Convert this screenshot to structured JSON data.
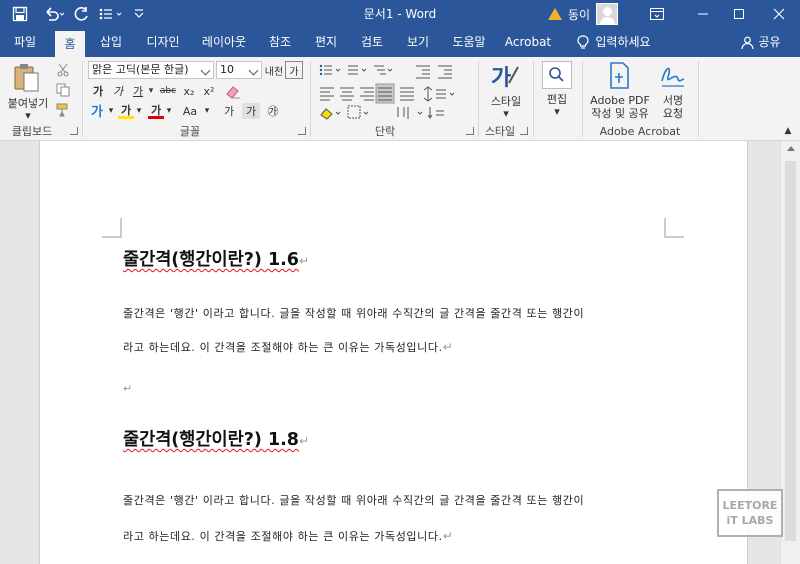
{
  "window": {
    "title": "문서1 - Word",
    "user_label": "동이"
  },
  "tabs": [
    "파일",
    "홈",
    "삽입",
    "디자인",
    "레이아웃",
    "참조",
    "편지",
    "검토",
    "보기",
    "도움말",
    "Acrobat",
    "입력하세요"
  ],
  "share_label": "공유",
  "ribbon": {
    "clipboard": {
      "paste_label": "붙여넣기",
      "group_label": "클립보드"
    },
    "font": {
      "font_name": "맑은 고딕(본문 한글)",
      "font_size": "10",
      "group_label": "글꼴",
      "buttons": [
        "가",
        "가",
        "가",
        "abc",
        "x₂",
        "x²",
        "가",
        "가",
        "Aa",
        "가",
        "가",
        "㉮",
        "내천",
        "가"
      ]
    },
    "paragraph": {
      "group_label": "단락"
    },
    "styles": {
      "button_label": "스타일",
      "group_label": "스타일"
    },
    "editing": {
      "button_label": "편집"
    },
    "acrobat": {
      "pdf_label_1": "Adobe PDF",
      "pdf_label_2": "작성 및 공유",
      "sign_label_1": "서명",
      "sign_label_2": "요청",
      "group_label": "Adobe Acrobat"
    }
  },
  "document": {
    "sections": [
      {
        "heading": "줄간격(행간이란?) 1.6",
        "line1": "줄간격은 '행간' 이라고 합니다. 글을 작성할 때 위아래 수직간의 글 간격을 줄간격 또는 행간이",
        "line2": "라고 하는데요. 이 간격을 조절해야 하는 큰 이유는 가독성입니다."
      },
      {
        "heading": "줄간격(행간이란?) 1.8",
        "line1": "줄간격은 '행간' 이라고 합니다. 글을 작성할 때 위아래 수직간의 글 간격을 줄간격 또는 행간이",
        "line2": "라고 하는데요. 이 간격을 조절해야 하는 큰 이유는 가독성입니다."
      }
    ]
  },
  "watermark": {
    "line1": "LEETORE",
    "line2": "iT LABS"
  },
  "colors": {
    "accent": "#2b579a",
    "ribbon_bg": "#f3f3f3",
    "page_bg": "#ffffff",
    "spell_error": "#e81123"
  },
  "icons": [
    "save-icon",
    "undo-icon",
    "redo-icon",
    "list-icon",
    "customize-icon",
    "warning-icon",
    "avatar-icon",
    "ribbon-display-icon",
    "minimize-icon",
    "maximize-icon",
    "close-icon",
    "lightbulb-icon",
    "share-icon"
  ]
}
